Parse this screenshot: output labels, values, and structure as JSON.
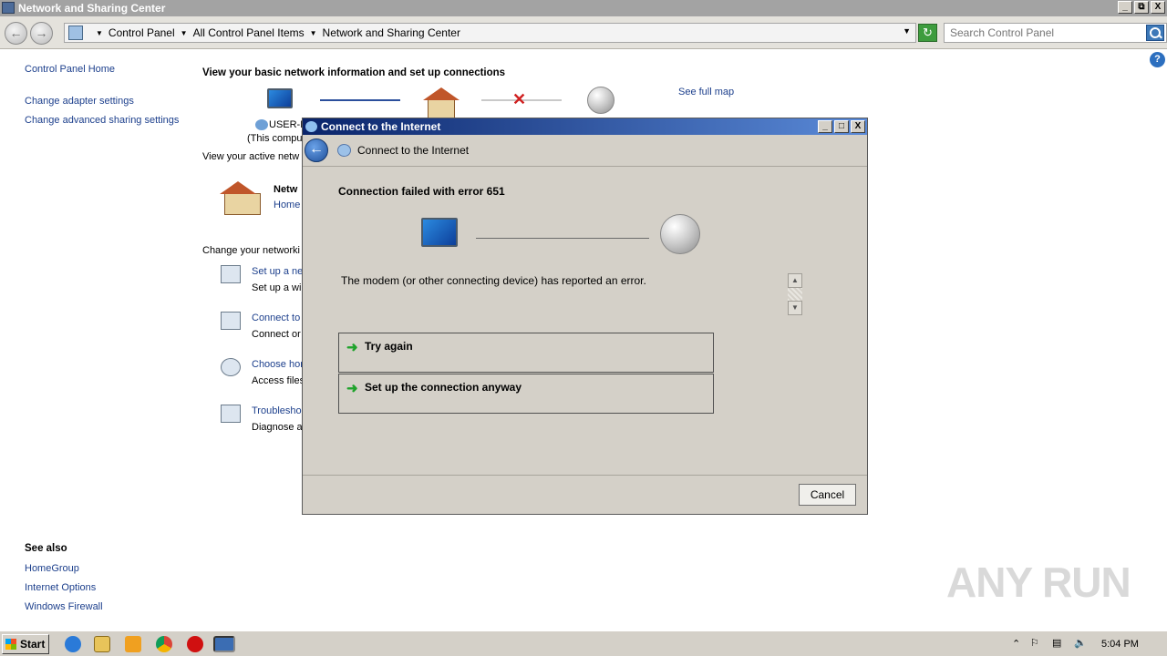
{
  "window": {
    "title": "Network and Sharing Center",
    "controls": [
      "_",
      "⧉",
      "X"
    ]
  },
  "address_bar": {
    "crumbs": [
      "Control Panel",
      "All Control Panel Items",
      "Network and Sharing Center"
    ],
    "search_placeholder": "Search Control Panel"
  },
  "help_glyph": "?",
  "left_nav": {
    "home": "Control Panel Home",
    "links": [
      "Change adapter settings",
      "Change advanced sharing settings"
    ],
    "see_also_title": "See also",
    "see_also": [
      "HomeGroup",
      "Internet Options",
      "Windows Firewall"
    ]
  },
  "main": {
    "heading": "View your basic network information and set up connections",
    "see_full_map": "See full map",
    "computer_label": "USER-F",
    "computer_sub": "(This compu",
    "active_networks": "View your active netw",
    "network_name": "Netw",
    "network_type": "Home",
    "change_settings": "Change your networki",
    "tasks": [
      {
        "title": "Set up a ne",
        "desc": "Set up a wi"
      },
      {
        "title": "Connect to",
        "desc": "Connect or"
      },
      {
        "title": "Choose hor",
        "desc": "Access files"
      },
      {
        "title": "Troublesho",
        "desc": "Diagnose a"
      }
    ]
  },
  "dialog": {
    "title": "Connect to the Internet",
    "header": "Connect to the Internet",
    "error_title": "Connection failed with error 651",
    "error_message": "The modem (or other connecting device) has reported an error.",
    "options": [
      "Try again",
      "Set up the connection anyway"
    ],
    "cancel_label": "Cancel"
  },
  "watermark": "ANY RUN",
  "taskbar": {
    "start_label": "Start",
    "clock": "5:04 PM"
  },
  "icons": [
    "back-icon",
    "forward-icon",
    "search-icon",
    "help-icon",
    "globe-icon",
    "computer-icon",
    "house-icon",
    "arrow-right-icon",
    "start-flag-icon"
  ]
}
